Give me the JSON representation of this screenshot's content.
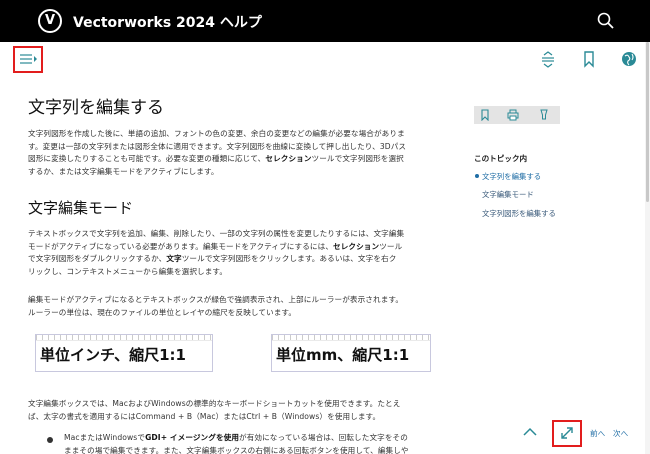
{
  "header": {
    "logo_letter": "V",
    "title": "Vectorworks 2024 ヘルプ"
  },
  "toolbar": {
    "icons": [
      "menu-icon",
      "expand-collapse-icon",
      "bookmark-icon",
      "globe-icon"
    ]
  },
  "article": {
    "title": "文字列を編集する",
    "intro": [
      "文字列図形を作成した後に、単語の追加、フォントの色の変更、余白の変更などの編集が必要な場合がありま",
      "す。変更は一部の文字列または図形全体に適用できます。文字列図形を曲線に変換して押し出したり、3Dパス",
      "図形に変換したりすることも可能です。必要な変更の種類に応じて、",
      "セレクション",
      "ツールで文字列図形を選択",
      "するか、または文字編集モードをアクティブにします。"
    ],
    "section_title": "文字編集モード",
    "section_p1": [
      "テキストボックスで文字列を追加、編集、削除したり、一部の文字列の属性を変更したりするには、文字編集",
      "モードがアクティブになっている必要があります。編集モードをアクティブにするには、",
      "セレクション",
      "ツール",
      "で文字列図形をダブルクリックするか、",
      "文字",
      "ツールで文字列図形をクリックします。あるいは、文字を右ク",
      "リックし、コンテキストメニューから編集を選択します。"
    ],
    "section_p2": [
      "編集モードがアクティブになるとテキストボックスが緑色で強調表示され、上部にルーラーが表示されます。",
      "ルーラーの単位は、現在のファイルの単位とレイヤの縮尺を反映しています。"
    ],
    "figures": [
      "単位インチ、縮尺1:1",
      "単位mm、縮尺1:1"
    ],
    "section_p3": [
      "文字編集ボックスでは、MacおよびWindowsの標準的なキーボードショートカットを使用できます。たとえ",
      "ば、太字の書式を適用するにはCommand + B（Mac）またはCtrl + B（Windows）を使用します。"
    ],
    "bullet": [
      "MacまたはWindowsで",
      "GDI+ イメージングを使用",
      "が有効になっている場合は、回転した文字をその",
      "ままその場で編集できます。また、文字編集ボックスの右側にある回転ボタンを使用して、編集しや"
    ]
  },
  "sidebar": {
    "toc_title": "このトピック内",
    "toc_items": [
      "文字列を編集する",
      "文字編集モード",
      "文字列図形を編集する"
    ],
    "tool_icons": [
      "bookmark-icon",
      "print-icon",
      "lightbulb-icon"
    ]
  },
  "footer_nav": {
    "prev": "前へ",
    "next": "次へ"
  },
  "colors": {
    "header_bg": "#000000",
    "accent": "#1f6da5",
    "highlight_border": "#e21d1d",
    "teal_icon": "#2a8a96"
  }
}
